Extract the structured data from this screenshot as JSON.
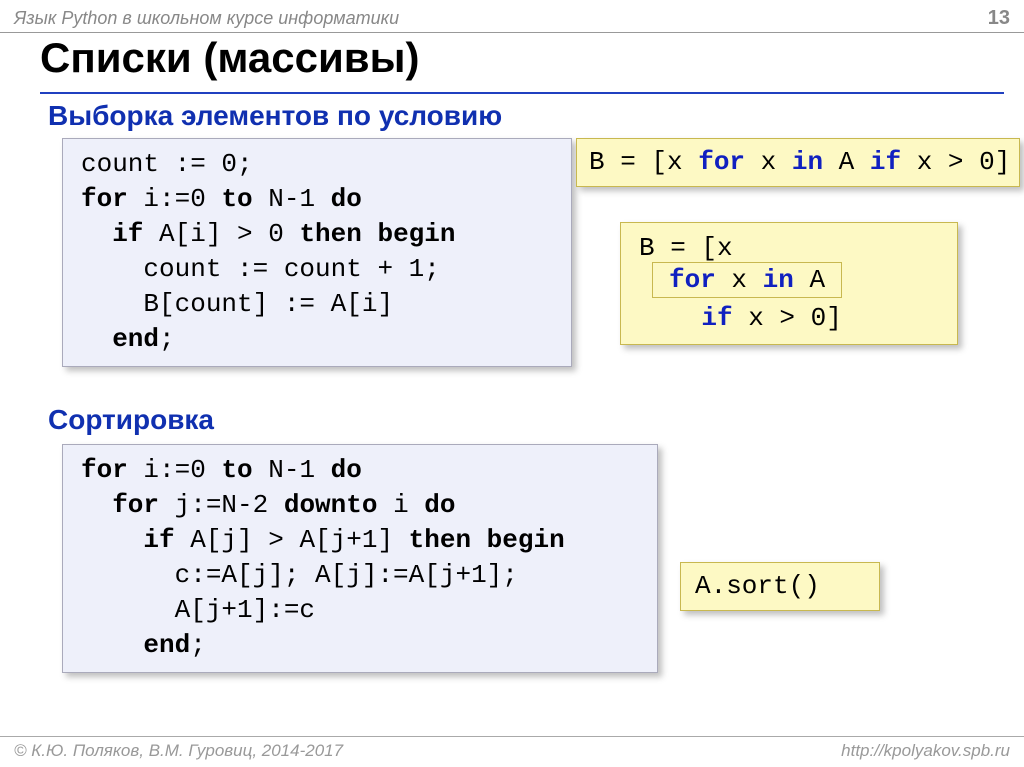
{
  "header": {
    "course": "Язык Python в школьном курсе информатики",
    "page": "13"
  },
  "title": "Списки (массивы)",
  "section1": "Выборка элементов по условию",
  "section2": "Сортировка",
  "pascal1": {
    "l1a": "count := 0;",
    "l2a": "for",
    "l2b": " i:=0 ",
    "l2c": "to",
    "l2d": " N-1 ",
    "l2e": "do",
    "l3a": "  if",
    "l3b": " A[i] > 0 ",
    "l3c": "then begin",
    "l4": "    count := count + 1;",
    "l5": "    B[count] := A[i]",
    "l6a": "  end",
    "l6b": ";"
  },
  "py1": {
    "a": "B = [x ",
    "for": "for",
    "b": " x ",
    "in": "in",
    "c": " A ",
    "if": "if",
    "d": " x > 0]"
  },
  "py2": {
    "l1": "B = [x",
    "l2a": "for",
    "l2b": " x ",
    "l2c": "in",
    "l2d": " A",
    "l3a": "    if",
    "l3b": " x > 0]"
  },
  "pascal2": {
    "l1a": "for",
    "l1b": " i:=0 ",
    "l1c": "to",
    "l1d": " N-1 ",
    "l1e": "do",
    "l2a": "  for",
    "l2b": " j:=N-2 ",
    "l2c": "downto",
    "l2d": " i ",
    "l2e": "do",
    "l3a": "    if",
    "l3b": " A[j] > A[j+1] ",
    "l3c": "then begin",
    "l4": "      c:=A[j]; A[j]:=A[j+1];",
    "l5": "      A[j+1]:=c",
    "l6a": "    end",
    "l6b": ";"
  },
  "py3": "A.sort()",
  "footer": {
    "left": "© К.Ю. Поляков, В.М. Гуровиц, 2014-2017",
    "right": "http://kpolyakov.spb.ru"
  }
}
